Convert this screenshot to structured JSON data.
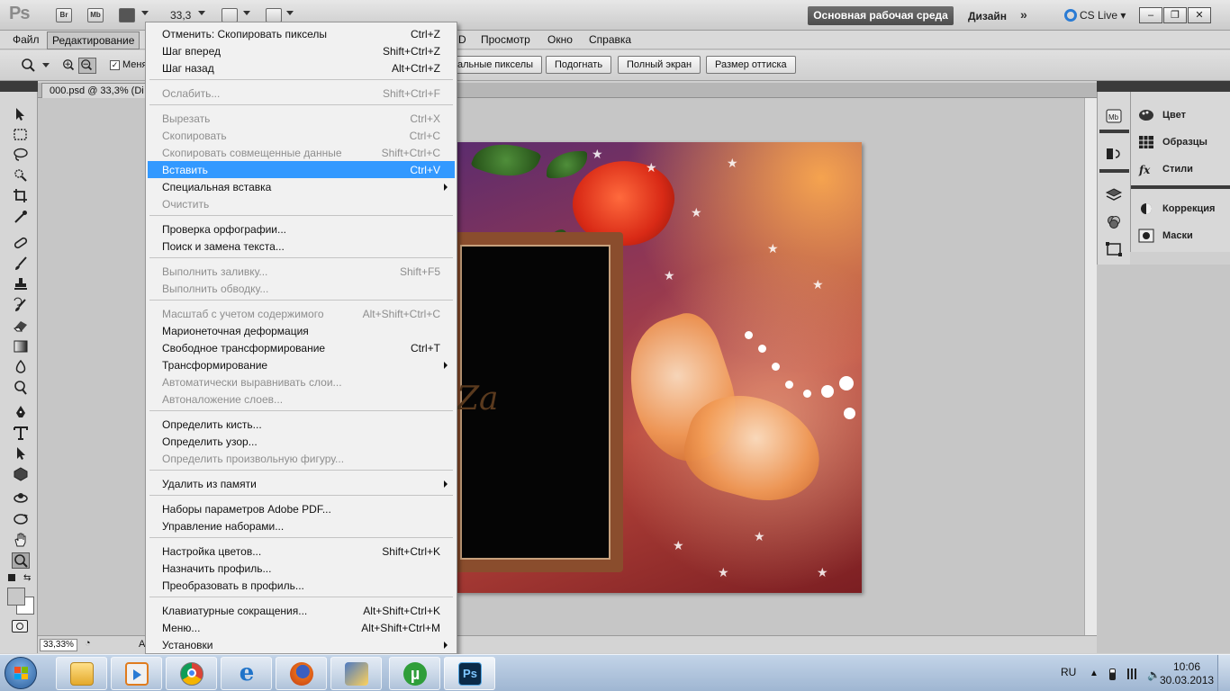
{
  "appbar": {
    "logo": "Ps",
    "bridge_label": "Br",
    "minibridge_label": "Mb",
    "zoom": "33,3",
    "workspace_active": "Основная рабочая среда",
    "workspace_design": "Дизайн",
    "cs_live": "CS Live",
    "window_buttons": [
      "–",
      "❐",
      "✕"
    ]
  },
  "menubar": {
    "items": [
      "Файл",
      "Редактирование",
      "D",
      "Просмотр",
      "Окно",
      "Справка"
    ]
  },
  "options": {
    "checkbox_label": "Меня",
    "buttons": [
      "альные пикселы",
      "Подогнать",
      "Полный экран",
      "Размер оттиска"
    ]
  },
  "document": {
    "tab_title": "000.psd @ 33,3% (Di",
    "zoom_status": "33,33%",
    "status_letter": "A",
    "image_text": "Za"
  },
  "edit_menu": {
    "items": [
      {
        "label": "Отменить: Скопировать пикселы",
        "shortcut": "Ctrl+Z",
        "state": "enabled"
      },
      {
        "label": "Шаг вперед",
        "shortcut": "Shift+Ctrl+Z",
        "state": "enabled"
      },
      {
        "label": "Шаг назад",
        "shortcut": "Alt+Ctrl+Z",
        "state": "enabled"
      },
      {
        "label": "Ослабить...",
        "shortcut": "Shift+Ctrl+F",
        "state": "disabled"
      },
      {
        "label": "Вырезать",
        "shortcut": "Ctrl+X",
        "state": "disabled"
      },
      {
        "label": "Скопировать",
        "shortcut": "Ctrl+C",
        "state": "disabled"
      },
      {
        "label": "Скопировать совмещенные данные",
        "shortcut": "Shift+Ctrl+C",
        "state": "disabled"
      },
      {
        "label": "Вставить",
        "shortcut": "Ctrl+V",
        "state": "highlight"
      },
      {
        "label": "Специальная вставка",
        "shortcut": "",
        "state": "enabled",
        "submenu": true
      },
      {
        "label": "Очистить",
        "shortcut": "",
        "state": "disabled"
      },
      {
        "label": "Проверка орфографии...",
        "shortcut": "",
        "state": "enabled"
      },
      {
        "label": "Поиск и замена текста...",
        "shortcut": "",
        "state": "enabled"
      },
      {
        "label": "Выполнить заливку...",
        "shortcut": "Shift+F5",
        "state": "disabled"
      },
      {
        "label": "Выполнить обводку...",
        "shortcut": "",
        "state": "disabled"
      },
      {
        "label": "Масштаб с учетом содержимого",
        "shortcut": "Alt+Shift+Ctrl+C",
        "state": "disabled"
      },
      {
        "label": "Марионеточная деформация",
        "shortcut": "",
        "state": "enabled"
      },
      {
        "label": "Свободное трансформирование",
        "shortcut": "Ctrl+T",
        "state": "enabled"
      },
      {
        "label": "Трансформирование",
        "shortcut": "",
        "state": "enabled",
        "submenu": true
      },
      {
        "label": "Автоматически выравнивать слои...",
        "shortcut": "",
        "state": "disabled"
      },
      {
        "label": "Автоналожение слоев...",
        "shortcut": "",
        "state": "disabled"
      },
      {
        "label": "Определить кисть...",
        "shortcut": "",
        "state": "enabled"
      },
      {
        "label": "Определить узор...",
        "shortcut": "",
        "state": "enabled"
      },
      {
        "label": "Определить произвольную фигуру...",
        "shortcut": "",
        "state": "disabled"
      },
      {
        "label": "Удалить из памяти",
        "shortcut": "",
        "state": "enabled",
        "submenu": true
      },
      {
        "label": "Наборы параметров Adobe PDF...",
        "shortcut": "",
        "state": "enabled"
      },
      {
        "label": "Управление наборами...",
        "shortcut": "",
        "state": "enabled"
      },
      {
        "label": "Настройка цветов...",
        "shortcut": "Shift+Ctrl+K",
        "state": "enabled"
      },
      {
        "label": "Назначить профиль...",
        "shortcut": "",
        "state": "enabled"
      },
      {
        "label": "Преобразовать в профиль...",
        "shortcut": "",
        "state": "enabled"
      },
      {
        "label": "Клавиатурные сокращения...",
        "shortcut": "Alt+Shift+Ctrl+K",
        "state": "enabled"
      },
      {
        "label": "Меню...",
        "shortcut": "Alt+Shift+Ctrl+M",
        "state": "enabled"
      },
      {
        "label": "Установки",
        "shortcut": "",
        "state": "enabled",
        "submenu": true
      }
    ]
  },
  "panels": {
    "group1": [
      "Цвет",
      "Образцы",
      "Стили"
    ],
    "group2": [
      "Коррекция",
      "Маски"
    ]
  },
  "taskbar": {
    "language": "RU",
    "time": "10:06",
    "date": "30.03.2013"
  },
  "colors": {
    "highlight": "#3399ff",
    "workspace_button": "#5a5a5a",
    "panel_dark": "#3b3b3b"
  }
}
